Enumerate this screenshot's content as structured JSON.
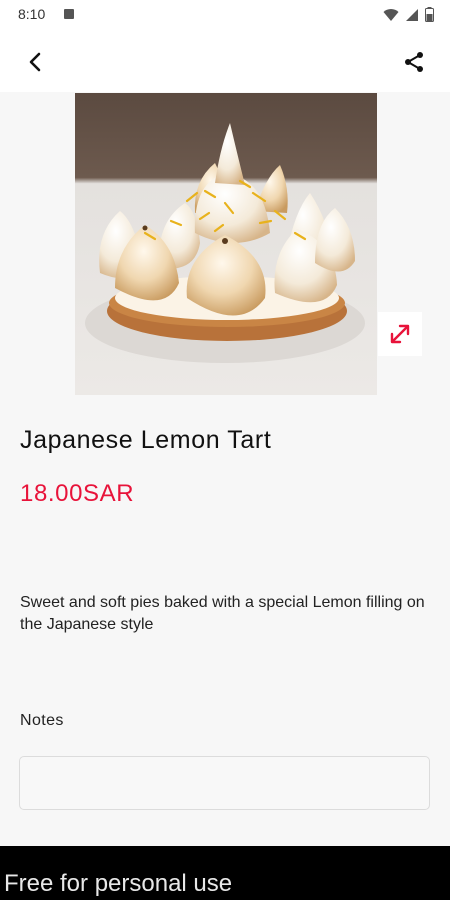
{
  "status_bar": {
    "time": "8:10"
  },
  "product": {
    "title": "Japanese Lemon Tart",
    "price": "18.00SAR",
    "description": "Sweet and soft pies baked with a special Lemon filling on the Japanese style"
  },
  "notes": {
    "label": "Notes",
    "value": "",
    "placeholder": ""
  },
  "footer": {
    "watermark": "Free for personal use"
  },
  "colors": {
    "accent": "#e8133a",
    "background": "#f7f7f7",
    "bottom_bar": "#000000"
  },
  "icons": {
    "back": "back-arrow-icon",
    "share": "share-icon",
    "expand": "expand-icon"
  }
}
